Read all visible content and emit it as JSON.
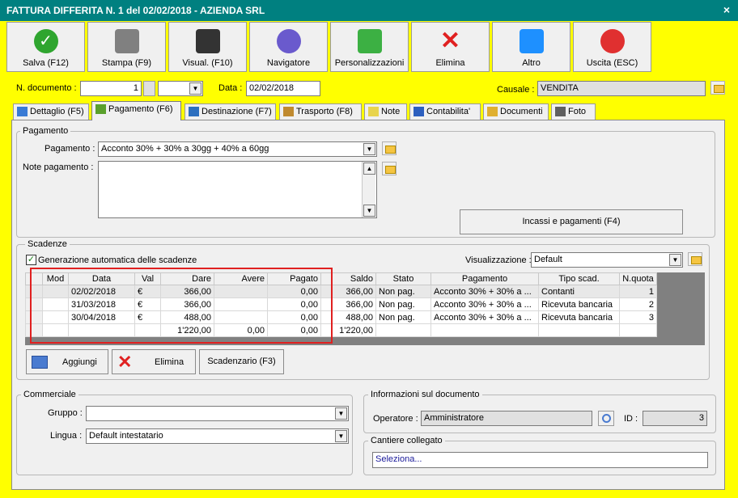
{
  "window": {
    "title": "FATTURA DIFFERITA N. 1 del 02/02/2018  -  AZIENDA SRL",
    "close": "×"
  },
  "toolbar": [
    {
      "label": "Salva (F12)",
      "icon": "check-icon",
      "color": "#2fa52f"
    },
    {
      "label": "Stampa (F9)",
      "icon": "printer-icon",
      "color": "#808080"
    },
    {
      "label": "Visual. (F10)",
      "icon": "magic-wand-icon",
      "color": "#333333"
    },
    {
      "label": "Navigatore",
      "icon": "compass-icon",
      "color": "#6a5acd"
    },
    {
      "label": "Personalizzazioni",
      "icon": "puzzle-icon",
      "color": "#3cb043"
    },
    {
      "label": "Elimina",
      "icon": "red-x-icon",
      "color": "#e02020"
    },
    {
      "label": "Altro",
      "icon": "magnifier-icon",
      "color": "#1e90ff"
    },
    {
      "label": "Uscita (ESC)",
      "icon": "power-icon",
      "color": "#e03030"
    }
  ],
  "header": {
    "doc_label": "N. documento :",
    "doc_number": "1",
    "doc_suffix": "",
    "data_label": "Data :",
    "data_value": "02/02/2018",
    "causale_label": "Causale :",
    "causale_value": "VENDITA"
  },
  "tabs": [
    {
      "label": "Dettaglio (F5)",
      "icon": "window-icon",
      "active": false
    },
    {
      "label": "Pagamento (F6)",
      "icon": "payment-icon",
      "active": true
    },
    {
      "label": "Destinazione (F7)",
      "icon": "globe-icon",
      "active": false
    },
    {
      "label": "Trasporto (F8)",
      "icon": "truck-icon",
      "active": false
    },
    {
      "label": "Note",
      "icon": "note-icon",
      "active": false
    },
    {
      "label": "Contabilita'",
      "icon": "book-icon",
      "active": false
    },
    {
      "label": "Documenti",
      "icon": "folder-icon",
      "active": false
    },
    {
      "label": "Foto",
      "icon": "camera-icon",
      "active": false
    }
  ],
  "pagamento": {
    "group_title": "Pagamento",
    "pagamento_label": "Pagamento :",
    "pagamento_value": "Acconto 30% + 30% a 30gg + 40% a 60gg",
    "note_label": "Note pagamento :",
    "note_value": "",
    "incassi_button": "Incassi e pagamenti (F4)"
  },
  "scadenze": {
    "group_title": "Scadenze",
    "auto_label": "Generazione automatica delle scadenze",
    "auto_checked": true,
    "visual_label": "Visualizzazione :",
    "visual_value": "Default",
    "columns": [
      "",
      "Mod",
      "Data",
      "Val",
      "Dare",
      "Avere",
      "Pagato",
      "Saldo",
      "Stato",
      "Pagamento",
      "Tipo scad.",
      "N.quota"
    ],
    "rows": [
      [
        "",
        "",
        "02/02/2018",
        "€",
        "366,00",
        "",
        "0,00",
        "366,00",
        "Non pag.",
        "Acconto 30% + 30% a ...",
        "Contanti",
        "1"
      ],
      [
        "",
        "",
        "31/03/2018",
        "€",
        "366,00",
        "",
        "0,00",
        "366,00",
        "Non pag.",
        "Acconto 30% + 30% a ...",
        "Ricevuta bancaria",
        "2"
      ],
      [
        "",
        "",
        "30/04/2018",
        "€",
        "488,00",
        "",
        "0,00",
        "488,00",
        "Non pag.",
        "Acconto 30% + 30% a ...",
        "Ricevuta bancaria",
        "3"
      ]
    ],
    "totals": [
      "",
      "",
      "",
      "",
      "1'220,00",
      "0,00",
      "0,00",
      "1'220,00",
      "",
      "",
      "",
      ""
    ],
    "add_button": "Aggiungi",
    "delete_button": "Elimina",
    "scadenzario_button": "Scadenzario (F3)"
  },
  "commerciale": {
    "group_title": "Commerciale",
    "gruppo_label": "Gruppo :",
    "gruppo_value": "",
    "lingua_label": "Lingua :",
    "lingua_value": "Default intestatario"
  },
  "info": {
    "group_title": "Informazioni sul documento",
    "operatore_label": "Operatore :",
    "operatore_value": "Amministratore",
    "id_label": "ID :",
    "id_value": "3"
  },
  "cantiere": {
    "group_title": "Cantiere collegato",
    "value": "Seleziona..."
  },
  "colors": {
    "background": "#ffff00",
    "titlebar": "#008080",
    "highlight_box": "#e02020"
  }
}
